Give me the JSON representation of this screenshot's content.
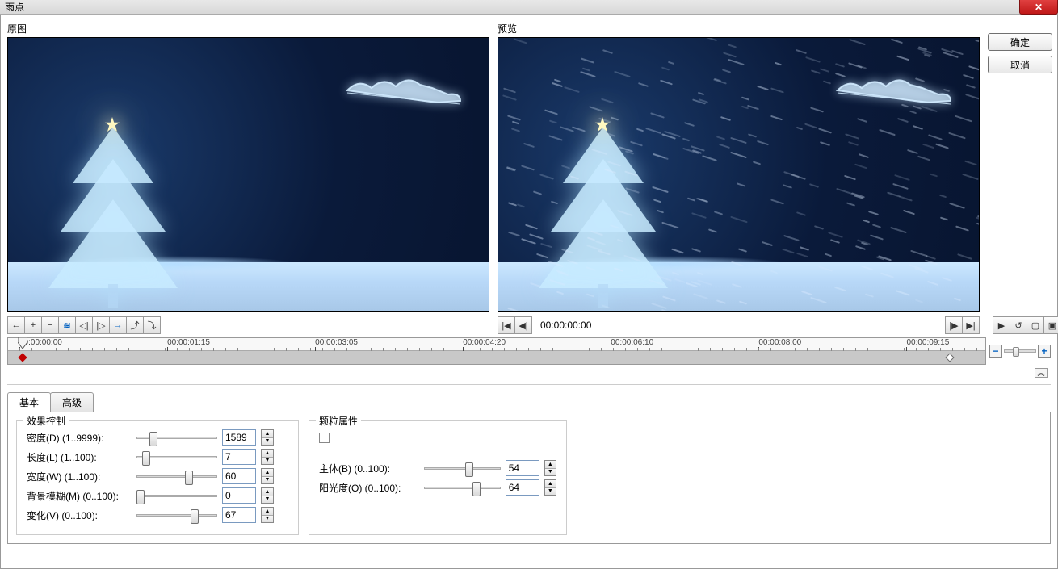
{
  "window": {
    "title": "雨点"
  },
  "labels": {
    "original": "原图",
    "preview": "预览"
  },
  "buttons": {
    "ok": "确定",
    "cancel": "取消"
  },
  "playback": {
    "time": "00:00:00:00"
  },
  "timeline": {
    "ticks": [
      "00:00:00:00",
      "00:00:01:15",
      "00:00:03:05",
      "00:00:04:20",
      "00:00:06:10",
      "00:00:08:00",
      "00:00:09:15"
    ]
  },
  "tabs": {
    "basic": "基本",
    "advanced": "高级"
  },
  "effect": {
    "section_label": "效果控制",
    "density": {
      "label": "密度(D) (1..9999):",
      "value": "1589",
      "pct": 16
    },
    "length": {
      "label": "长度(L) (1..100):",
      "value": "7",
      "pct": 7
    },
    "width": {
      "label": "宽度(W) (1..100):",
      "value": "60",
      "pct": 60
    },
    "bg_blur": {
      "label": "背景模糊(M) (0..100):",
      "value": "0",
      "pct": 0
    },
    "variation": {
      "label": "变化(V) (0..100):",
      "value": "67",
      "pct": 67
    }
  },
  "particle": {
    "section_label": "颗粒属性",
    "checkbox_checked": false,
    "body": {
      "label": "主体(B) (0..100):",
      "value": "54",
      "pct": 54
    },
    "opacity": {
      "label": "阳光度(O) (0..100):",
      "value": "64",
      "pct": 64
    }
  }
}
